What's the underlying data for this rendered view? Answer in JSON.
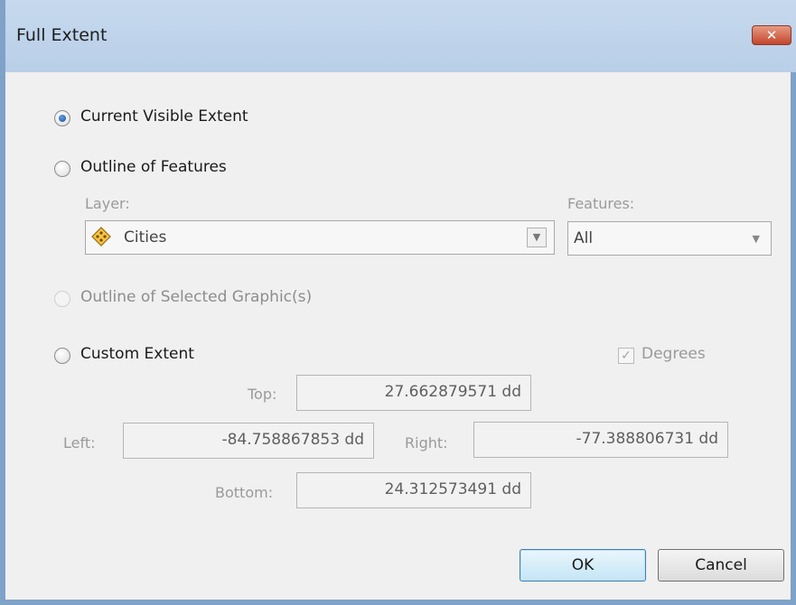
{
  "window": {
    "title": "Full Extent",
    "close_icon": "close-icon",
    "close_glyph": "✕"
  },
  "options": {
    "current_visible_extent": {
      "label": "Current Visible Extent",
      "selected": true
    },
    "outline_of_features": {
      "label": "Outline of Features",
      "selected": false
    },
    "outline_selected_graphics": {
      "label": "Outline of Selected Graphic(s)",
      "selected": false,
      "enabled": false
    },
    "custom_extent": {
      "label": "Custom Extent",
      "selected": false
    }
  },
  "layer": {
    "label": "Layer:",
    "value": "Cities",
    "icon": "point-layer-icon"
  },
  "features": {
    "label": "Features:",
    "value": "All"
  },
  "degrees": {
    "label": "Degrees",
    "checked": true,
    "check_glyph": "✓"
  },
  "extent": {
    "top_label": "Top:",
    "top_value": "27.662879571 dd",
    "left_label": "Left:",
    "left_value": "-84.758867853 dd",
    "right_label": "Right:",
    "right_value": "-77.388806731 dd",
    "bottom_label": "Bottom:",
    "bottom_value": "24.312573491 dd"
  },
  "buttons": {
    "ok": "OK",
    "cancel": "Cancel"
  },
  "colors": {
    "titlebar": "#c6d9ee",
    "close_button": "#c4452c",
    "ok_border": "#3c7fb1",
    "layer_icon_fill": "#f4c542"
  }
}
